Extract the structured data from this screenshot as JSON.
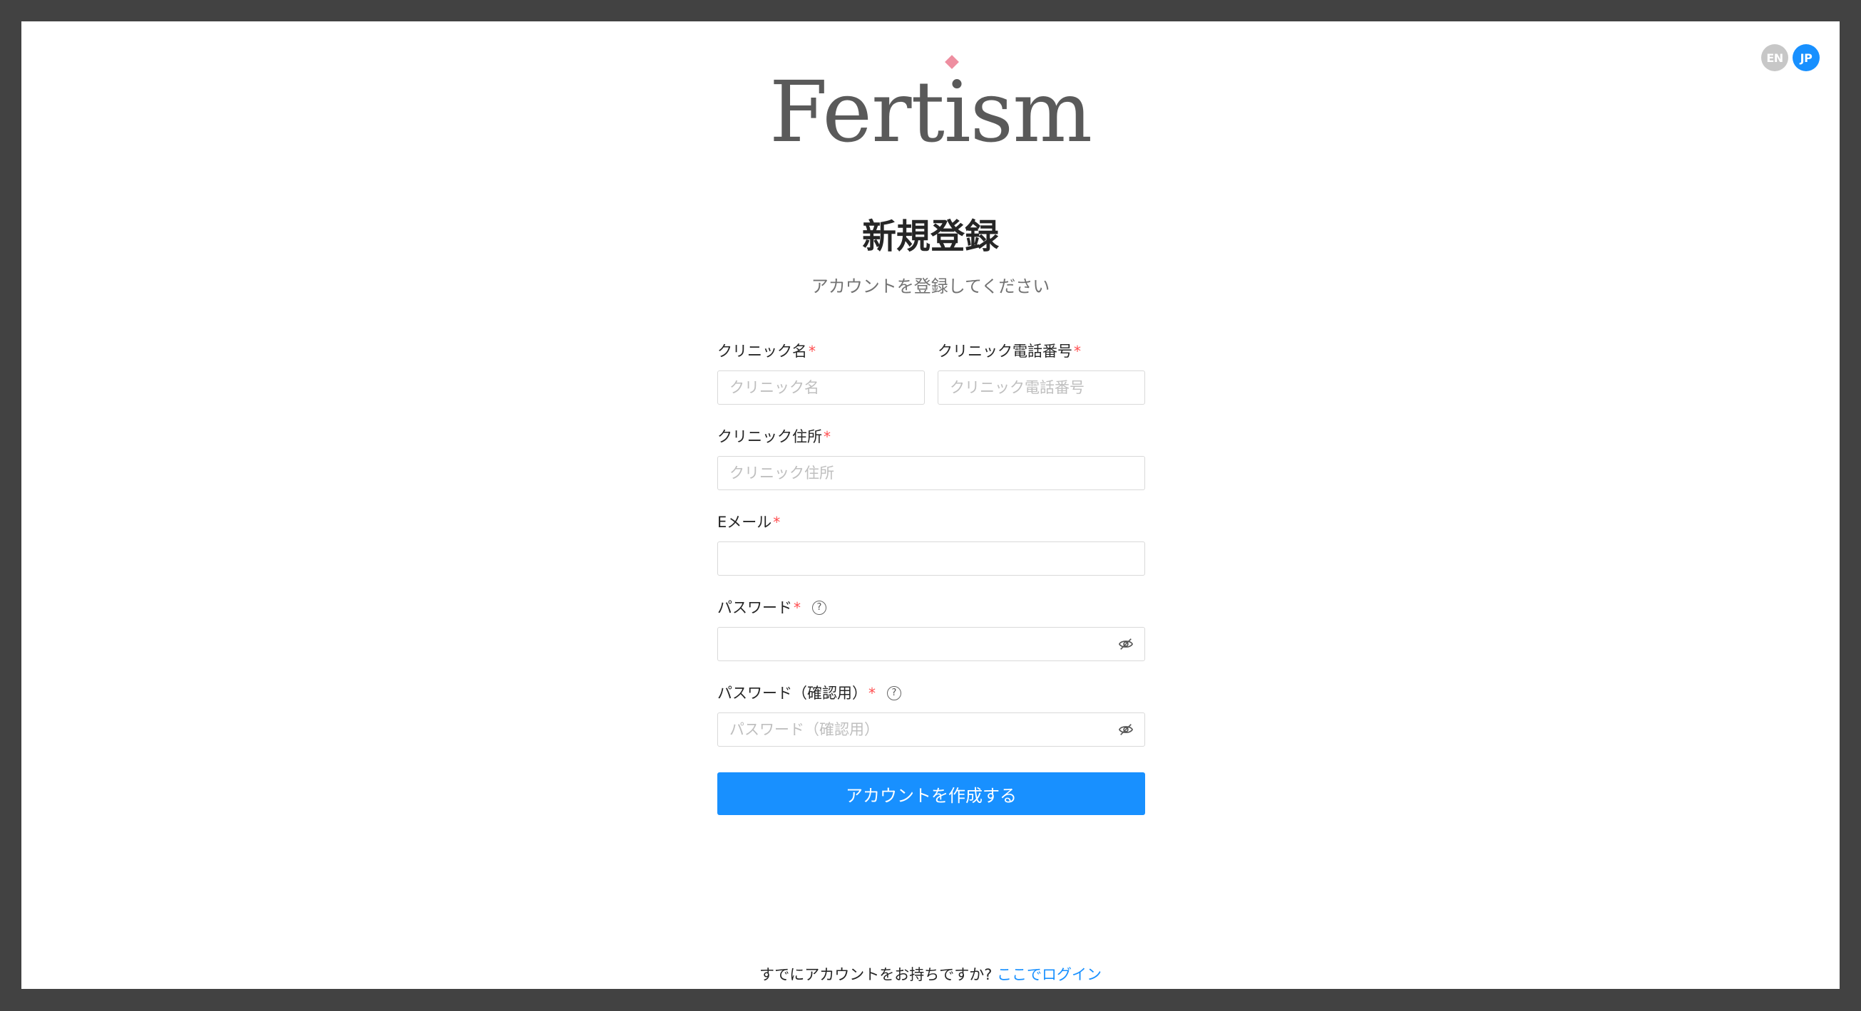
{
  "lang": {
    "en": "EN",
    "jp": "JP",
    "active": "JP"
  },
  "logo": {
    "text": "Fertism"
  },
  "header": {
    "title": "新規登録",
    "subtitle": "アカウントを登録してください"
  },
  "form": {
    "required_mark": "*",
    "clinic_name": {
      "label": "クリニック名",
      "placeholder": "クリニック名",
      "value": ""
    },
    "clinic_phone": {
      "label": "クリニック電話番号",
      "placeholder": "クリニック電話番号",
      "value": ""
    },
    "clinic_address": {
      "label": "クリニック住所",
      "placeholder": "クリニック住所",
      "value": ""
    },
    "email": {
      "label": "Eメール",
      "placeholder": "",
      "value": ""
    },
    "password": {
      "label": "パスワード",
      "placeholder": "",
      "value": ""
    },
    "password_confirm": {
      "label": "パスワード（確認用）",
      "placeholder": "パスワード（確認用）",
      "value": ""
    },
    "submit_label": "アカウントを作成する"
  },
  "footer": {
    "text": "すでにアカウントをお持ちですか? ",
    "link": "ここでログイン"
  },
  "colors": {
    "primary": "#1890ff",
    "required": "#ff4d4f",
    "logo": "#5a5a5a",
    "logo_accent": "#ee8ea0"
  },
  "icons": [
    "question-circle-icon",
    "eye-invisible-icon"
  ]
}
